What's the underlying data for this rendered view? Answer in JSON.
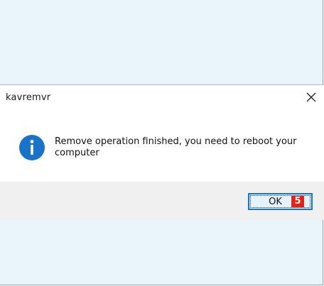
{
  "dialog": {
    "title": "kavremvr",
    "message": "Remove operation finished, you need to reboot your computer",
    "icon": "info-icon",
    "close_icon": "close-icon"
  },
  "buttons": {
    "ok_label": "OK",
    "ok_badge": "5"
  },
  "colors": {
    "desktop_bg": "#eaf4fb",
    "info_blue": "#1a73c9",
    "button_border": "#0a78d7",
    "badge_red": "#e2231a",
    "footer_bg": "#f0f0f0"
  }
}
